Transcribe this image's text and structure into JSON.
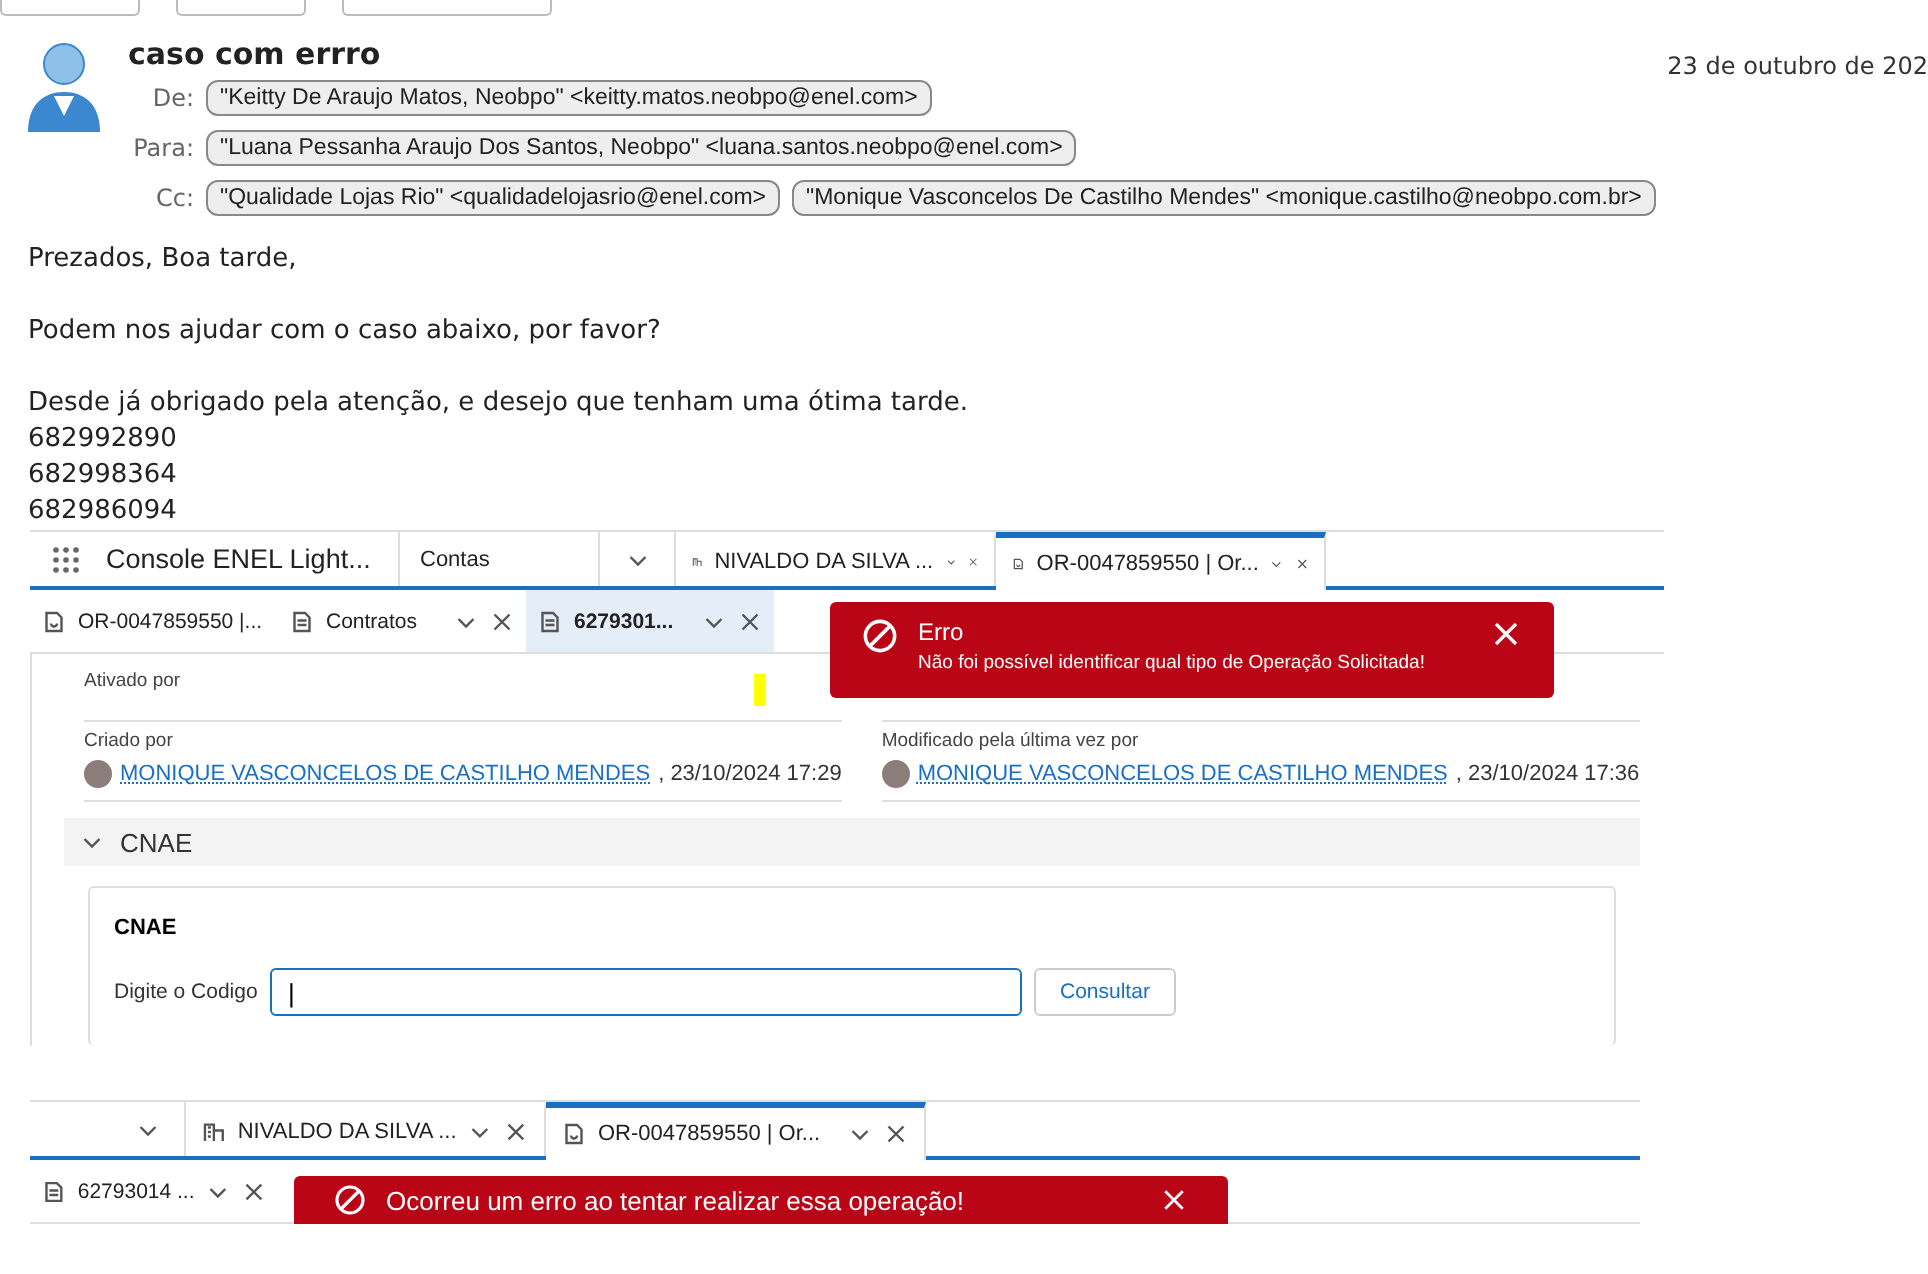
{
  "email": {
    "subject": "caso com errro",
    "date": "23 de outubro de 202",
    "headers": [
      {
        "label": "De:",
        "chips": [
          "\"Keitty De Araujo Matos, Neobpo\" <keitty.matos.neobpo@enel.com>"
        ]
      },
      {
        "label": "Para:",
        "chips": [
          "\"Luana Pessanha Araujo Dos Santos, Neobpo\" <luana.santos.neobpo@enel.com>"
        ]
      },
      {
        "label": "Cc:",
        "chips": [
          "\"Qualidade Lojas Rio\" <qualidadelojasrio@enel.com>",
          "\"Monique Vasconcelos De Castilho Mendes\" <monique.castilho@neobpo.com.br>"
        ]
      }
    ],
    "body": [
      [
        "Prezados, Boa tarde,"
      ],
      [
        "Podem  nos ajudar com o caso abaixo, por favor?"
      ],
      [
        "Desde já obrigado pela atenção, e desejo que tenham uma ótima tarde.",
        "682992890",
        "682998364",
        "682986094"
      ]
    ]
  },
  "shot1": {
    "app_name": "Console ENEL Light...",
    "nav_item": "Contas",
    "tabs": [
      {
        "label": "NIVALDO DA SILVA ...",
        "kind": "account",
        "selected": false
      },
      {
        "label": "OR-0047859550 | Or...",
        "kind": "order",
        "selected": true
      }
    ],
    "subtabs": [
      {
        "label": "OR-0047859550 |...",
        "kind": "order",
        "selected": false,
        "closable": false
      },
      {
        "label": "Contratos",
        "kind": "doc",
        "selected": false,
        "closable": true
      },
      {
        "label": "6279301...",
        "kind": "doc",
        "selected": true,
        "closable": true
      }
    ],
    "activated_label": "Ativado por",
    "created": {
      "label": "Criado por",
      "user": "MONIQUE VASCONCELOS DE CASTILHO MENDES",
      "date": ", 23/10/2024 17:29"
    },
    "modified": {
      "label": "Modificado pela última vez por",
      "user": "MONIQUE VASCONCELOS DE CASTILHO MENDES",
      "date": ", 23/10/2024 17:36"
    },
    "section": {
      "title": "CNAE",
      "expanded": true,
      "card_title": "CNAE",
      "field_label": "Digite o Codigo",
      "field_value": "|",
      "button": "Consultar"
    },
    "toast": {
      "title": "Erro",
      "message": "Não foi possível identificar qual tipo de Operação Solicitada!"
    }
  },
  "shot2": {
    "tabs": [
      {
        "label": "NIVALDO DA SILVA ...",
        "kind": "account",
        "selected": false
      },
      {
        "label": "OR-0047859550 | Or...",
        "kind": "order",
        "selected": true
      }
    ],
    "subtab": "62793014 ...",
    "toast": "Ocorreu um erro ao tentar realizar essa operação!"
  }
}
